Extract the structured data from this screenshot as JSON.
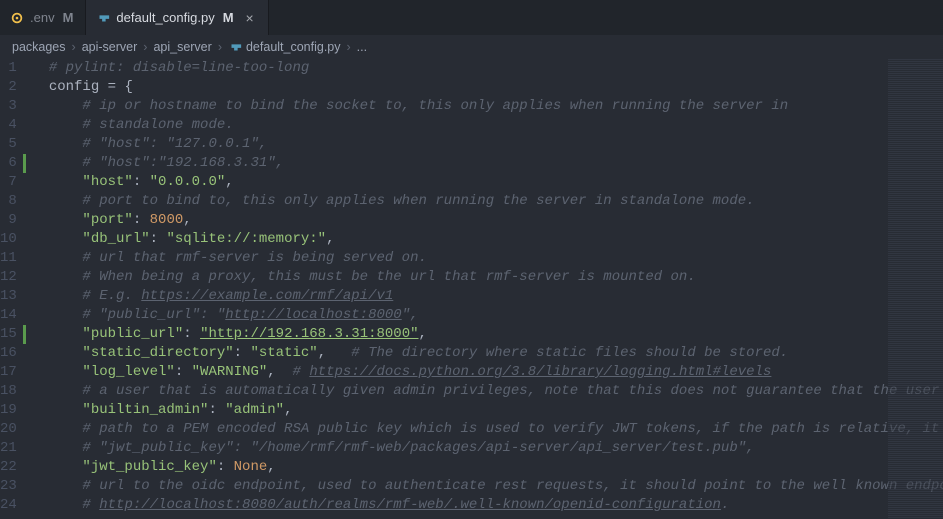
{
  "tabs": [
    {
      "icon": "#f2c04c",
      "iconType": "gear",
      "label": ".env",
      "dirty": "M",
      "active": false
    },
    {
      "icon": "#519aba",
      "iconType": "python",
      "label": "default_config.py",
      "dirty": "M",
      "active": true,
      "close": "×"
    }
  ],
  "breadcrumbs": {
    "parts": [
      "packages",
      "api-server",
      "api_server",
      "default_config.py",
      "..."
    ],
    "sep": "›",
    "fileIcon": "#519aba"
  },
  "gutter": {
    "lines": [
      "1",
      "2",
      "3",
      "4",
      "5",
      "6",
      "7",
      "8",
      "9",
      "10",
      "11",
      "12",
      "13",
      "14",
      "15",
      "16",
      "17",
      "18",
      "19",
      "20",
      "21",
      "22",
      "23",
      "24"
    ],
    "modified": [
      6,
      15
    ]
  },
  "code": {
    "l1": "# pylint: disable=line-too-long",
    "l2a": "config",
    "l2b": " = ",
    "l2c": "{",
    "l3": "# ip or hostname to bind the socket to, this only applies when running the server in",
    "l4": "# standalone mode.",
    "l5": "# \"host\": \"127.0.0.1\",",
    "l6": "# \"host\":\"192.168.3.31\",",
    "l7k": "\"host\"",
    "l7v": "\"0.0.0.0\"",
    "l8": "# port to bind to, this only applies when running the server in standalone mode.",
    "l9k": "\"port\"",
    "l9v": "8000",
    "l10k": "\"db_url\"",
    "l10v": "\"sqlite://:memory:\"",
    "l11": "# url that rmf-server is being served on.",
    "l12": "# When being a proxy, this must be the url that rmf-server is mounted on.",
    "l13a": "# E.g. ",
    "l13b": "https://example.com/rmf/api/v1",
    "l14a": "# \"public_url\": \"",
    "l14b": "http://localhost:8000",
    "l14c": "\",",
    "l15k": "\"public_url\"",
    "l15v": "\"http://192.168.3.31:8000\"",
    "l16k": "\"static_directory\"",
    "l16v": "\"static\"",
    "l16c": "# The directory where static files should be stored.",
    "l17k": "\"log_level\"",
    "l17v": "\"WARNING\"",
    "l17c": "# ",
    "l17u": "https://docs.python.org/3.8/library/logging.html#levels",
    "l18": "# a user that is automatically given admin privileges, note that this does not guarantee that the user exists ",
    "l19k": "\"builtin_admin\"",
    "l19v": "\"admin\"",
    "l20": "# path to a PEM encoded RSA public key which is used to verify JWT tokens, if the path is relative, it is base",
    "l21": "# \"jwt_public_key\": \"/home/rmf/rmf-web/packages/api-server/api_server/test.pub\",",
    "l22k": "\"jwt_public_key\"",
    "l22v": "None",
    "l23": "# url to the oidc endpoint, used to authenticate rest requests, it should point to the well known endpoint, e.",
    "l24a": "# ",
    "l24b": "http://localhost:8080/auth/realms/rmf-web/.well-known/openid-configuration",
    "l24c": "."
  },
  "punct": {
    "colon": ": ",
    "comma": ",",
    "indent1": "    ",
    "indent2": "        ",
    "commaSp": ",   ",
    "commaSp2": ",  "
  }
}
